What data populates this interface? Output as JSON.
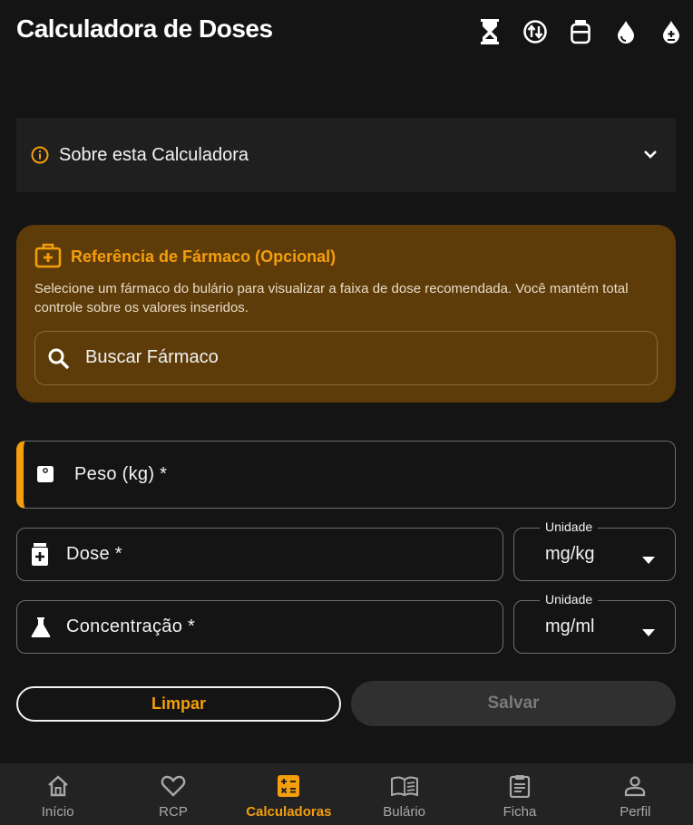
{
  "app_bar": {
    "title": "Calculadora de Doses",
    "actions": [
      "hourglass-icon",
      "conversion-icon",
      "vial-icon",
      "drop-icon",
      "drop-plus-icon"
    ]
  },
  "about": {
    "label": "Sobre esta Calculadora"
  },
  "reference": {
    "title": "Referência de Fármaco (Opcional)",
    "description": "Selecione um fármaco do bulário para visualizar a faixa de dose recomendada. Você mantém total controle sobre os valores inseridos.",
    "search_placeholder": "Buscar Fármaco"
  },
  "form": {
    "peso_label": "Peso (kg) *",
    "dose_label": "Dose *",
    "concentracao_label": "Concentração *",
    "dose_unit": {
      "legend": "Unidade",
      "value": "mg/kg"
    },
    "concentracao_unit": {
      "legend": "Unidade",
      "value": "mg/ml"
    }
  },
  "buttons": {
    "clear": "Limpar",
    "save": "Salvar"
  },
  "nav": {
    "items": [
      {
        "label": "Início",
        "icon": "home-icon"
      },
      {
        "label": "RCP",
        "icon": "heart-icon"
      },
      {
        "label": "Calculadoras",
        "icon": "calculator-icon",
        "active": true
      },
      {
        "label": "Bulário",
        "icon": "book-icon"
      },
      {
        "label": "Ficha",
        "icon": "clipboard-icon"
      },
      {
        "label": "Perfil",
        "icon": "person-icon"
      }
    ]
  },
  "colors": {
    "accent": "#f59e0b",
    "background": "#141414",
    "reference_card": "#5e3c09"
  }
}
